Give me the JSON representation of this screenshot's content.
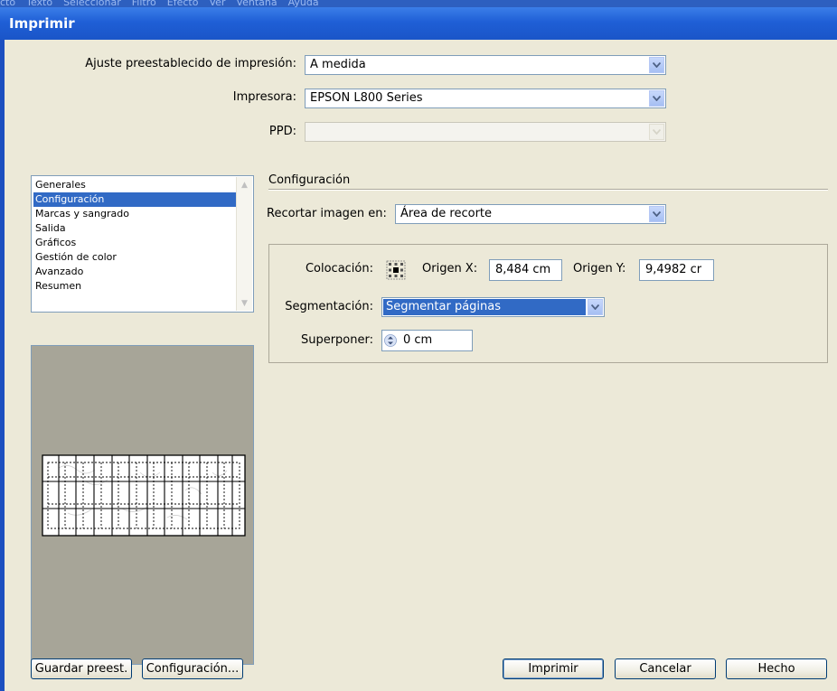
{
  "app_menu": [
    "cto",
    "Texto",
    "Seleccionar",
    "Filtro",
    "Efecto",
    "Ver",
    "Ventana",
    "Ayuda"
  ],
  "dialog": {
    "title": "Imprimir"
  },
  "top_fields": {
    "preset_label": "Ajuste preestablecido de impresión:",
    "preset_value": "A medida",
    "printer_label": "Impresora:",
    "printer_value": "EPSON L800 Series",
    "ppd_label": "PPD:",
    "ppd_value": ""
  },
  "categories": [
    {
      "label": "Generales",
      "selected": false
    },
    {
      "label": "Configuración",
      "selected": true
    },
    {
      "label": "Marcas y sangrado",
      "selected": false
    },
    {
      "label": "Salida",
      "selected": false
    },
    {
      "label": "Gráficos",
      "selected": false
    },
    {
      "label": "Gestión de color",
      "selected": false
    },
    {
      "label": "Avanzado",
      "selected": false
    },
    {
      "label": "Resumen",
      "selected": false
    }
  ],
  "settings": {
    "section_title": "Configuración",
    "crop_label": "Recortar imagen en:",
    "crop_value": "Área de recorte",
    "placement_label": "Colocación:",
    "origin_x_label": "Origen X:",
    "origin_x_value": "8,484 cm",
    "origin_y_label": "Origen Y:",
    "origin_y_value": "9,4982 cr",
    "tiling_label": "Segmentación:",
    "tiling_value": "Segmentar páginas",
    "overlap_label": "Superponer:",
    "overlap_value": "0 cm"
  },
  "buttons": {
    "save_preset": "Guardar preest.",
    "setup": "Configuración...",
    "print": "Imprimir",
    "cancel": "Cancelar",
    "done": "Hecho"
  },
  "colors": {
    "titlebar": "#1f5fd6",
    "dialog_bg": "#ece9d8",
    "selection": "#316ac5",
    "preview_bg": "#a7a598"
  }
}
